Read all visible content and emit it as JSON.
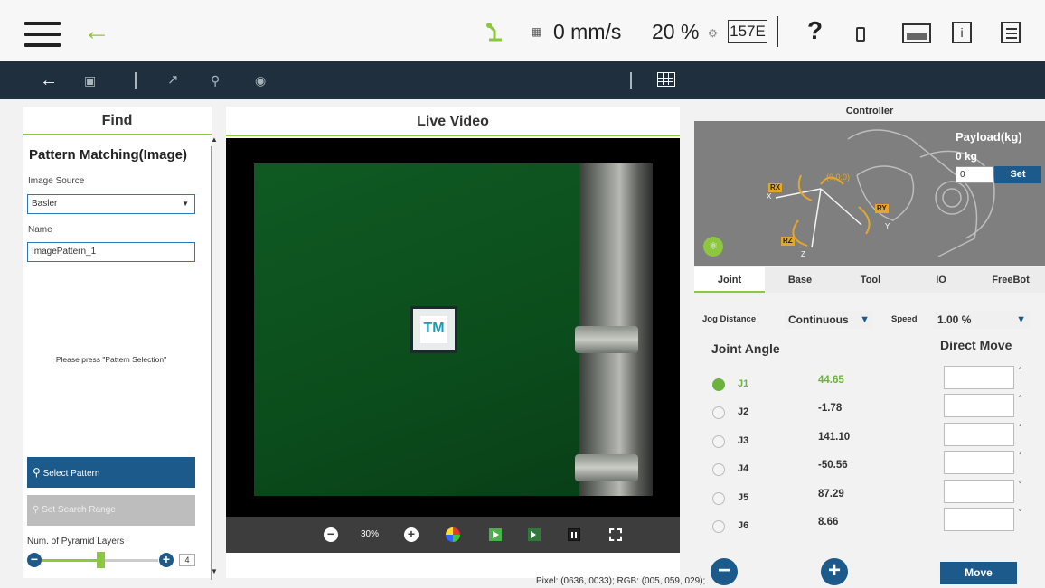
{
  "header": {
    "speed_text": "0 mm/s",
    "percent_text": "20 %",
    "code_text": "157E",
    "help_text": "?",
    "info_text": "i"
  },
  "find": {
    "title": "Find",
    "pattern_title": "Pattern Matching(Image)",
    "image_source_label": "Image Source",
    "image_source_value": "Basler",
    "name_label": "Name",
    "name_value": "ImagePattern_1",
    "prompt": "Please press \"Pattern Selection\"",
    "select_pattern": "Select Pattern",
    "set_search_range": "Set Search Range",
    "pyramid_label": "Num. of Pyramid Layers",
    "pyramid_value": "4",
    "pyramid_fraction": 0.5
  },
  "video": {
    "title": "Live Video",
    "zoom": "30%",
    "pixel_info": "Pixel: (0636, 0033); RGB: (005, 059, 029);"
  },
  "controller": {
    "title": "Controller",
    "payload_label": "Payload(kg)",
    "payload_value": "0 kg",
    "payload_input": "0",
    "set_label": "Set",
    "origin": "(0,0,0)",
    "axes": {
      "rx": "RX",
      "ry": "RY",
      "rz": "RZ",
      "x": "X",
      "y": "Y",
      "z": "Z"
    },
    "tabs": [
      "Joint",
      "Base",
      "Tool",
      "IO",
      "FreeBot"
    ],
    "jog_distance_label": "Jog Distance",
    "jog_distance_value": "Continuous",
    "speed_label": "Speed",
    "speed_value": "1.00 %",
    "joint_angle_title": "Joint Angle",
    "direct_move_title": "Direct Move",
    "degree_symbol": "°",
    "move_label": "Move",
    "joints": [
      {
        "name": "J1",
        "value": "44.65",
        "selected": true
      },
      {
        "name": "J2",
        "value": "-1.78",
        "selected": false
      },
      {
        "name": "J3",
        "value": "141.10",
        "selected": false
      },
      {
        "name": "J4",
        "value": "-50.56",
        "selected": false
      },
      {
        "name": "J5",
        "value": "87.29",
        "selected": false
      },
      {
        "name": "J6",
        "value": "8.66",
        "selected": false
      }
    ]
  },
  "colors": {
    "accent_green": "#8dc63f",
    "primary_blue": "#1b5a8a",
    "toolbar_bg": "#1f2f3d"
  }
}
